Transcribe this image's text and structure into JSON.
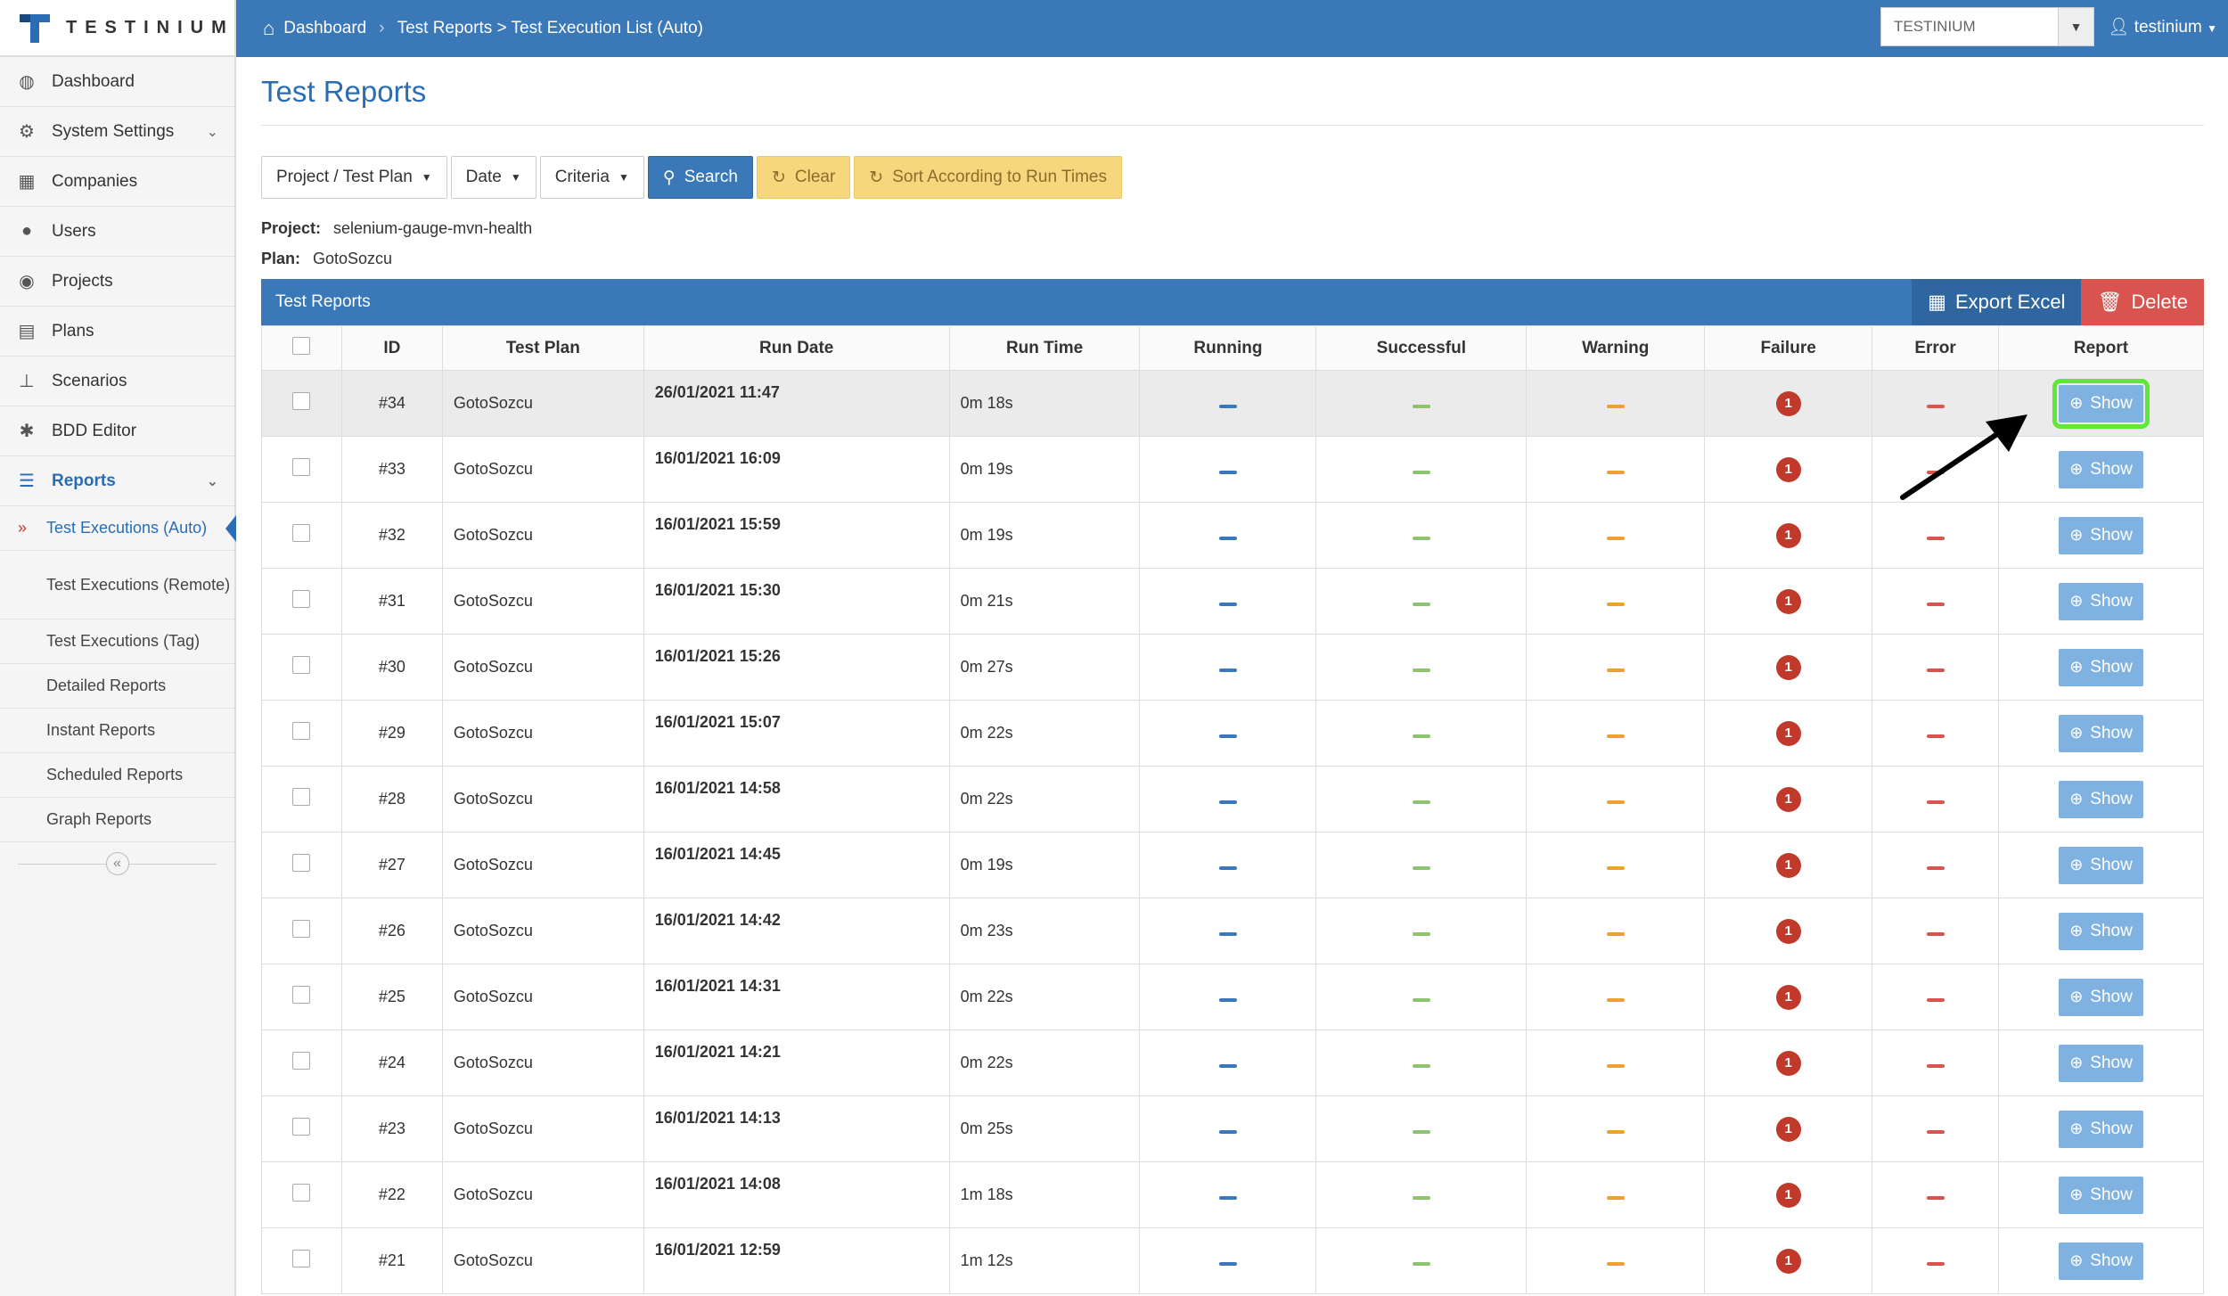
{
  "brand": {
    "name": "TESTINIUM",
    "color": "#2a6db5"
  },
  "sidebar": {
    "items": [
      {
        "label": "Dashboard",
        "icon": "dashboard-icon",
        "glyph": "◍"
      },
      {
        "label": "System Settings",
        "icon": "gears-icon",
        "glyph": "⚙",
        "chevron": true
      },
      {
        "label": "Companies",
        "icon": "building-icon",
        "glyph": "▦"
      },
      {
        "label": "Users",
        "icon": "user-icon",
        "glyph": "●"
      },
      {
        "label": "Projects",
        "icon": "globe-icon",
        "glyph": "◉"
      },
      {
        "label": "Plans",
        "icon": "calendar-icon",
        "glyph": "▤"
      },
      {
        "label": "Scenarios",
        "icon": "sitemap-icon",
        "glyph": "⊥"
      },
      {
        "label": "BDD Editor",
        "icon": "bug-icon",
        "glyph": "✱"
      },
      {
        "label": "Reports",
        "icon": "list-icon",
        "glyph": "☰",
        "chevron": true,
        "active": true
      }
    ],
    "sub_items": [
      {
        "label": "Test Executions (Auto)",
        "current": true
      },
      {
        "label": "Test Executions (Remote)",
        "tall": true
      },
      {
        "label": "Test Executions (Tag)"
      },
      {
        "label": "Detailed Reports"
      },
      {
        "label": "Instant Reports"
      },
      {
        "label": "Scheduled Reports"
      },
      {
        "label": "Graph Reports"
      }
    ],
    "collapse_glyph": "«"
  },
  "topbar": {
    "breadcrumb": [
      "Dashboard",
      "Test Reports > Test Execution List (Auto)"
    ],
    "tenant": "TESTINIUM",
    "user": "testinium"
  },
  "page": {
    "title": "Test Reports",
    "filters": {
      "project_plan": "Project / Test Plan",
      "date": "Date",
      "criteria": "Criteria",
      "search": "Search",
      "clear": "Clear",
      "sort": "Sort According to Run Times"
    },
    "project_label": "Project:",
    "project_value": "selenium-gauge-mvn-health",
    "plan_label": "Plan:",
    "plan_value": "GotoSozcu"
  },
  "panel": {
    "title": "Test Reports",
    "export_label": "Export Excel",
    "delete_label": "Delete"
  },
  "table": {
    "columns": [
      "ID",
      "Test Plan",
      "Run Date",
      "Run Time",
      "Running",
      "Successful",
      "Warning",
      "Failure",
      "Error",
      "Report"
    ],
    "show_label": "Show",
    "rows": [
      {
        "id": "#34",
        "plan": "GotoSozcu",
        "date": "26/01/2021 11:47",
        "time": "0m 18s",
        "failure": "1"
      },
      {
        "id": "#33",
        "plan": "GotoSozcu",
        "date": "16/01/2021 16:09",
        "time": "0m 19s",
        "failure": "1"
      },
      {
        "id": "#32",
        "plan": "GotoSozcu",
        "date": "16/01/2021 15:59",
        "time": "0m 19s",
        "failure": "1"
      },
      {
        "id": "#31",
        "plan": "GotoSozcu",
        "date": "16/01/2021 15:30",
        "time": "0m 21s",
        "failure": "1"
      },
      {
        "id": "#30",
        "plan": "GotoSozcu",
        "date": "16/01/2021 15:26",
        "time": "0m 27s",
        "failure": "1"
      },
      {
        "id": "#29",
        "plan": "GotoSozcu",
        "date": "16/01/2021 15:07",
        "time": "0m 22s",
        "failure": "1"
      },
      {
        "id": "#28",
        "plan": "GotoSozcu",
        "date": "16/01/2021 14:58",
        "time": "0m 22s",
        "failure": "1"
      },
      {
        "id": "#27",
        "plan": "GotoSozcu",
        "date": "16/01/2021 14:45",
        "time": "0m 19s",
        "failure": "1"
      },
      {
        "id": "#26",
        "plan": "GotoSozcu",
        "date": "16/01/2021 14:42",
        "time": "0m 23s",
        "failure": "1"
      },
      {
        "id": "#25",
        "plan": "GotoSozcu",
        "date": "16/01/2021 14:31",
        "time": "0m 22s",
        "failure": "1"
      },
      {
        "id": "#24",
        "plan": "GotoSozcu",
        "date": "16/01/2021 14:21",
        "time": "0m 22s",
        "failure": "1"
      },
      {
        "id": "#23",
        "plan": "GotoSozcu",
        "date": "16/01/2021 14:13",
        "time": "0m 25s",
        "failure": "1"
      },
      {
        "id": "#22",
        "plan": "GotoSozcu",
        "date": "16/01/2021 14:08",
        "time": "1m 18s",
        "failure": "1"
      },
      {
        "id": "#21",
        "plan": "GotoSozcu",
        "date": "16/01/2021 12:59",
        "time": "1m 12s",
        "failure": "1"
      }
    ]
  },
  "colors": {
    "running": "#3a78b8",
    "successful": "#8dc26f",
    "warning": "#f0a030",
    "error": "#d9534f",
    "failure_badge": "#c0392b",
    "highlight_outline": "#5ee837"
  }
}
